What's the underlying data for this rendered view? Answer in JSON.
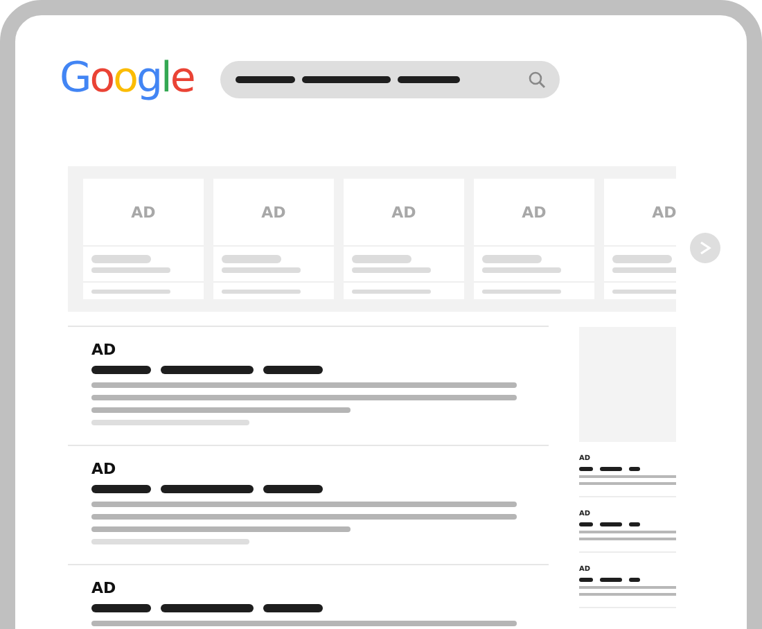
{
  "logo": {
    "letters": [
      {
        "char": "G",
        "color": "#4285f4"
      },
      {
        "char": "o",
        "color": "#ea4335"
      },
      {
        "char": "o",
        "color": "#fbbc05"
      },
      {
        "char": "g",
        "color": "#4285f4"
      },
      {
        "char": "l",
        "color": "#34a853"
      },
      {
        "char": "e",
        "color": "#ea4335"
      }
    ]
  },
  "carousel": {
    "cards": [
      {
        "label": "AD"
      },
      {
        "label": "AD"
      },
      {
        "label": "AD"
      },
      {
        "label": "AD"
      },
      {
        "label": "AD"
      }
    ]
  },
  "results": [
    {
      "label": "AD"
    },
    {
      "label": "AD"
    },
    {
      "label": "AD"
    }
  ],
  "side_ads": [
    {
      "label": "AD"
    },
    {
      "label": "AD"
    },
    {
      "label": "AD"
    }
  ]
}
